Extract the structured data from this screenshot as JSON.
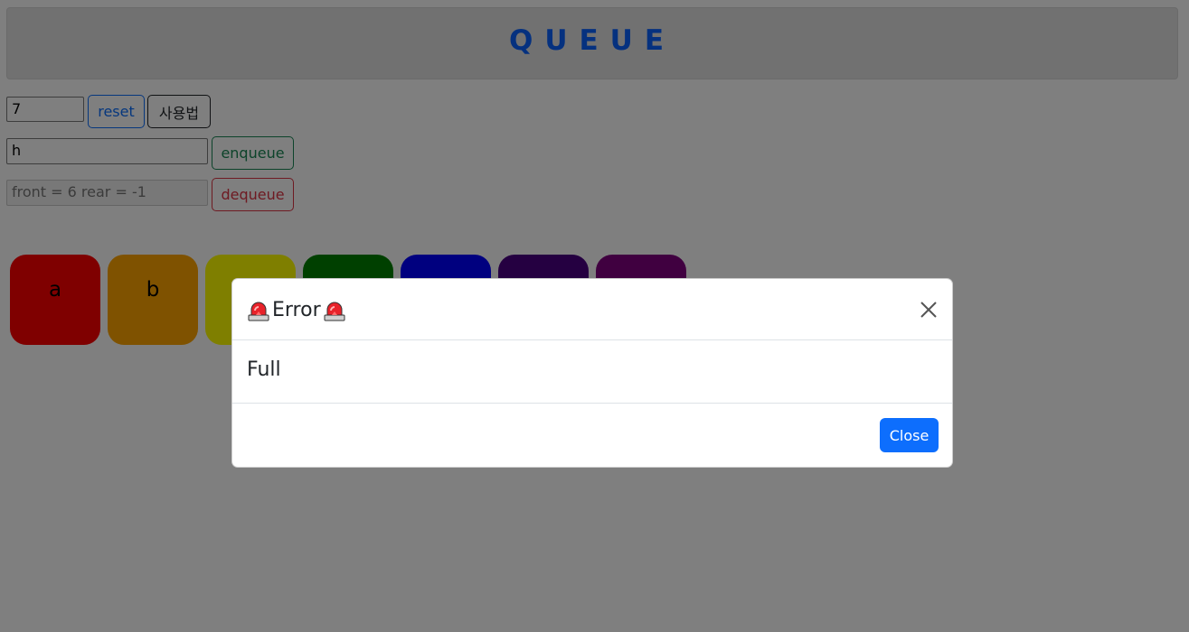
{
  "header": {
    "title": "QUEUE"
  },
  "controls": {
    "size_value": "7",
    "reset_label": "reset",
    "help_label": "사용법",
    "enqueue_value": "h",
    "enqueue_label": "enqueue",
    "status_value": "front = 6 rear = -1",
    "dequeue_label": "dequeue"
  },
  "queue": {
    "cells": [
      {
        "label": "a",
        "color": "#ff0000"
      },
      {
        "label": "b",
        "color": "#ffa500"
      },
      {
        "label": "",
        "color": "#ffff00"
      },
      {
        "label": "",
        "color": "#008000"
      },
      {
        "label": "",
        "color": "#0000ff"
      },
      {
        "label": "",
        "color": "#4b0082"
      },
      {
        "label": "",
        "color": "#800080"
      }
    ]
  },
  "modal": {
    "title": "Error",
    "title_icon": "siren-icon",
    "message": "Full",
    "close_label": "Close"
  },
  "colors": {
    "accent_blue": "#0d6efd",
    "header_title": "#0b63ff",
    "success": "#198754",
    "danger": "#dc3545"
  }
}
